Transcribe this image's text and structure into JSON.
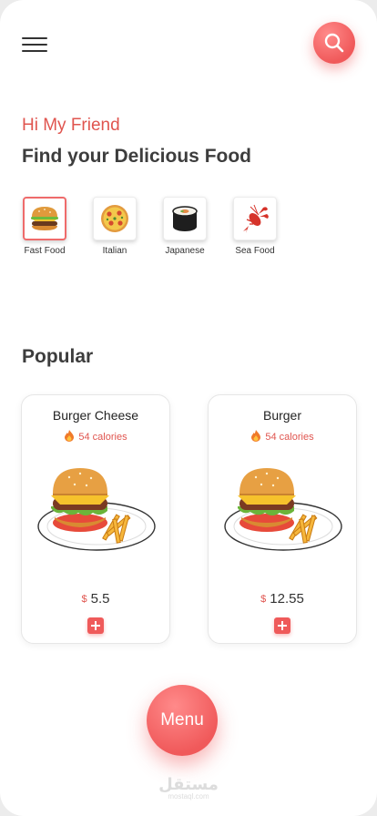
{
  "header": {
    "menu_icon": "hamburger-menu-icon",
    "search_icon": "search-icon"
  },
  "greeting": "Hi My Friend",
  "headline": "Find your Delicious Food",
  "categories": [
    {
      "label": "Fast Food",
      "icon": "burger-icon",
      "active": true
    },
    {
      "label": "Italian",
      "icon": "pizza-icon",
      "active": false
    },
    {
      "label": "Japanese",
      "icon": "sushi-icon",
      "active": false
    },
    {
      "label": "Sea Food",
      "icon": "lobster-icon",
      "active": false
    }
  ],
  "popular": {
    "title": "Popular",
    "items": [
      {
        "name": "Burger Cheese",
        "calories": "54 calories",
        "currency": "$",
        "price": "5.5"
      },
      {
        "name": "Burger",
        "calories": "54 calories",
        "currency": "$",
        "price": "12.55"
      }
    ]
  },
  "menu_button": "Menu",
  "watermark": {
    "arabic": "مستقل",
    "url": "mostaql.com"
  },
  "colors": {
    "accent": "#f0595a",
    "accent_text": "#e0554f"
  }
}
